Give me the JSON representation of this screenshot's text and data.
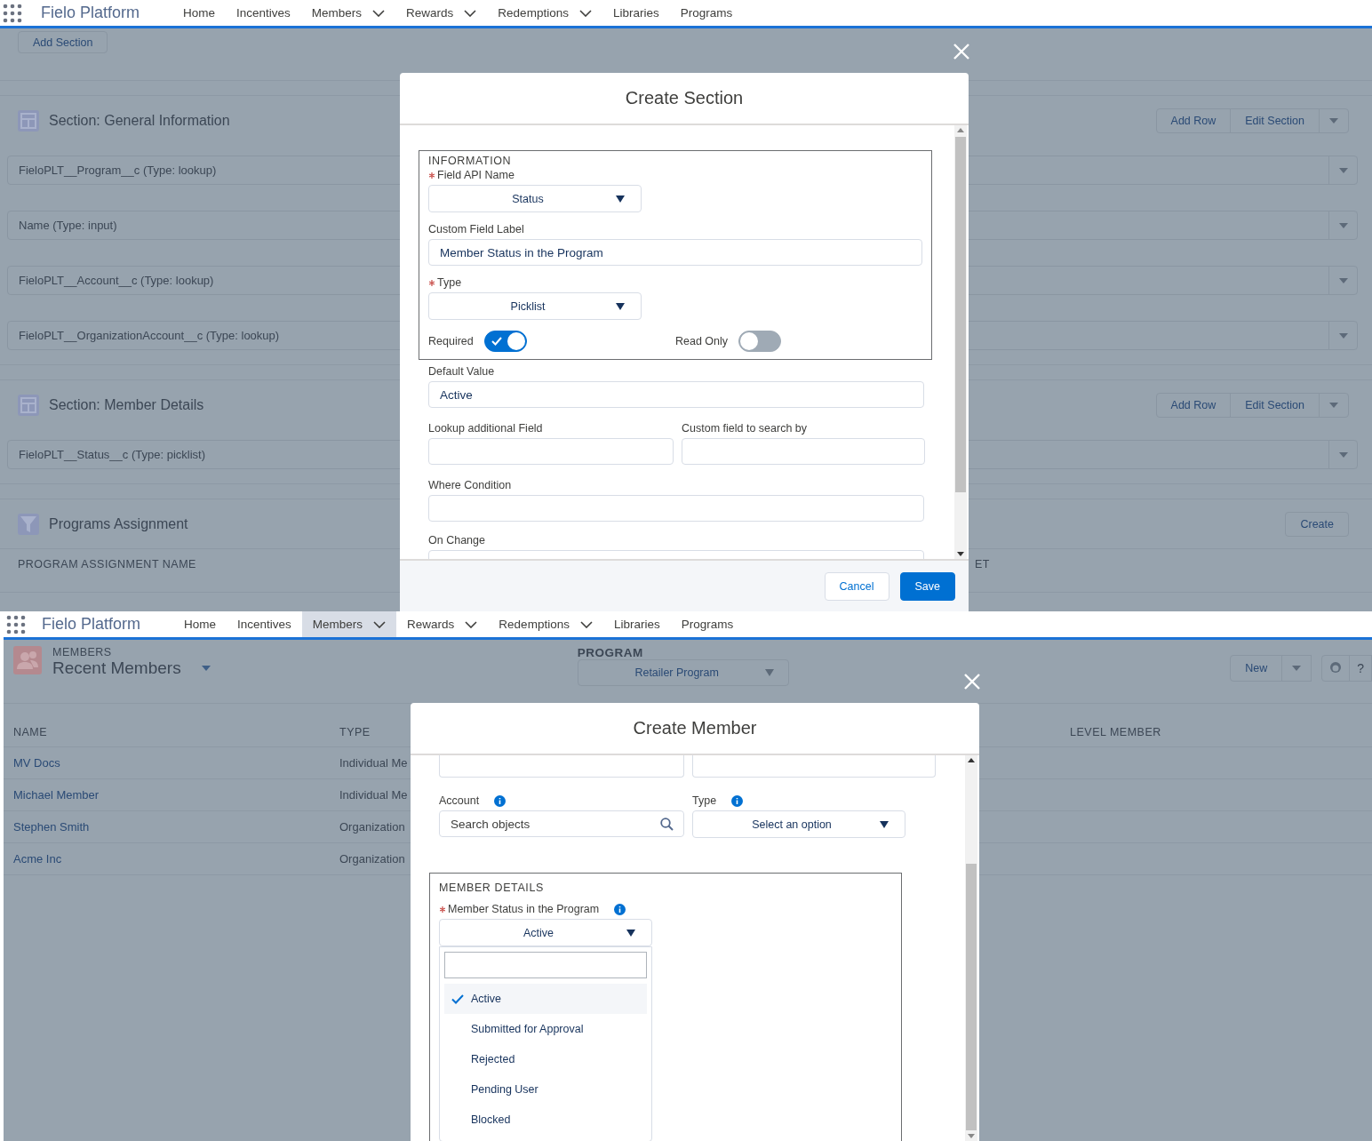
{
  "section_editor": {
    "nav": {
      "app_name": "Fielo Platform",
      "items": [
        {
          "label": "Home",
          "dropdown": false,
          "selected": false
        },
        {
          "label": "Incentives",
          "dropdown": false,
          "selected": false
        },
        {
          "label": "Members",
          "dropdown": true,
          "selected": false
        },
        {
          "label": "Rewards",
          "dropdown": true,
          "selected": false
        },
        {
          "label": "Redemptions",
          "dropdown": true,
          "selected": false
        },
        {
          "label": "Libraries",
          "dropdown": false,
          "selected": false
        },
        {
          "label": "Programs",
          "dropdown": false,
          "selected": false
        }
      ]
    },
    "add_section": "Add Section",
    "sections": [
      {
        "title": "Section: General Information",
        "kind": "layout",
        "actions": [
          "Add Row",
          "Edit Section"
        ],
        "menu": true,
        "rows": [
          "FieloPLT__Program__c (Type: lookup)",
          "Name (Type: input)",
          "FieloPLT__Account__c (Type: lookup)",
          "FieloPLT__OrganizationAccount__c (Type: lookup)"
        ]
      },
      {
        "title": "Section: Member Details",
        "kind": "layout",
        "actions": [
          "Add Row",
          "Edit Section"
        ],
        "menu": true,
        "rows": [
          "FieloPLT__Status__c (Type: picklist)"
        ]
      },
      {
        "title": "Programs Assignment",
        "kind": "filter",
        "actions": [
          "Create"
        ],
        "menu": false,
        "columns": [
          "PROGRAM ASSIGNMENT NAME",
          "ET"
        ]
      }
    ],
    "modal": {
      "title": "Create Section",
      "fieldset": {
        "legend": "INFORMATION",
        "field_api_name": {
          "label": "Field API Name",
          "required": true,
          "value": "Status"
        },
        "custom_field_label": {
          "label": "Custom Field Label",
          "value": "Member Status in the Program"
        },
        "type": {
          "label": "Type",
          "required": true,
          "value": "Picklist"
        },
        "toggles": [
          {
            "label": "Required",
            "on": true
          },
          {
            "label": "Read Only",
            "on": false
          }
        ]
      },
      "default_value": {
        "label": "Default Value",
        "value": "Active"
      },
      "lookup_additional_field": {
        "label": "Lookup additional Field"
      },
      "custom_field_to_search_by": {
        "label": "Custom field to search by"
      },
      "where_condition": {
        "label": "Where Condition"
      },
      "on_change": {
        "label": "On Change"
      },
      "buttons": [
        {
          "label": "Cancel",
          "kind": "neutral"
        },
        {
          "label": "Save",
          "kind": "brand"
        }
      ]
    }
  },
  "members_page": {
    "nav": {
      "app_name": "Fielo Platform",
      "items": [
        {
          "label": "Home",
          "dropdown": false,
          "selected": false
        },
        {
          "label": "Incentives",
          "dropdown": false,
          "selected": false
        },
        {
          "label": "Members",
          "dropdown": true,
          "selected": true
        },
        {
          "label": "Rewards",
          "dropdown": true,
          "selected": false
        },
        {
          "label": "Redemptions",
          "dropdown": true,
          "selected": false
        },
        {
          "label": "Libraries",
          "dropdown": false,
          "selected": false
        },
        {
          "label": "Programs",
          "dropdown": false,
          "selected": false
        }
      ]
    },
    "object_label": "MEMBERS",
    "list_view": "Recent Members",
    "program": {
      "label": "PROGRAM",
      "value": "Retailer Program"
    },
    "new_button": "New",
    "help": "?",
    "columns": [
      "NAME",
      "TYPE",
      "LEVEL MEMBER"
    ],
    "rows": [
      {
        "name": "MV Docs",
        "type": "Individual Me"
      },
      {
        "name": "Michael Member",
        "type": "Individual Me"
      },
      {
        "name": "Stephen Smith",
        "type": "Organization"
      },
      {
        "name": "Acme Inc",
        "type": "Organization"
      }
    ],
    "modal": {
      "title": "Create Member",
      "account": {
        "label": "Account",
        "placeholder": "Search objects"
      },
      "type": {
        "label": "Type",
        "value": "Select an option"
      },
      "fieldset": {
        "legend": "MEMBER DETAILS",
        "status": {
          "label": "Member Status in the Program",
          "required": true,
          "value": "Active"
        },
        "options": [
          {
            "label": "Active",
            "selected": true
          },
          {
            "label": "Submitted for Approval",
            "selected": false
          },
          {
            "label": "Rejected",
            "selected": false
          },
          {
            "label": "Pending User",
            "selected": false
          },
          {
            "label": "Blocked",
            "selected": false
          }
        ]
      }
    }
  }
}
